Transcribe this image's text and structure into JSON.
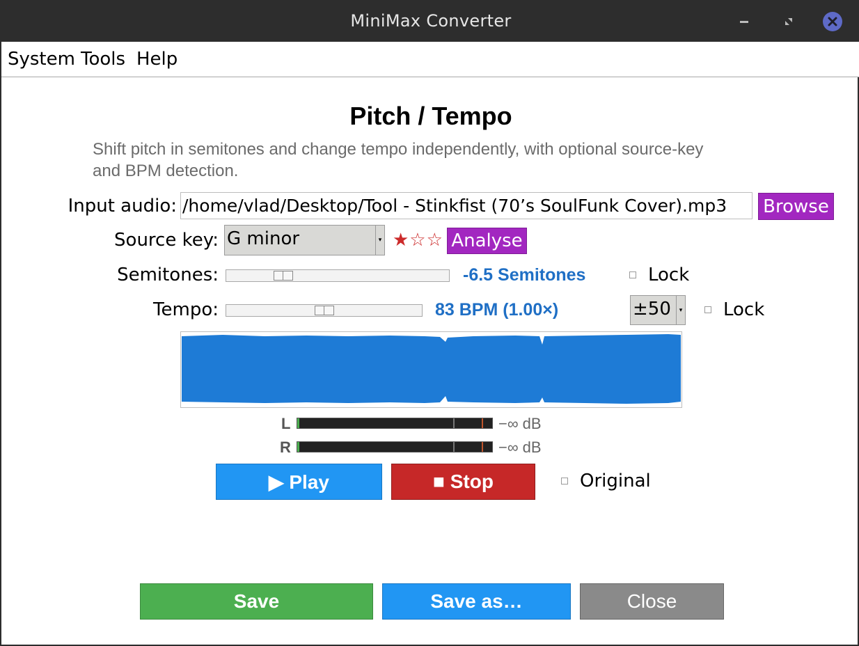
{
  "window": {
    "title": "MiniMax Converter"
  },
  "menu": {
    "items": [
      "System",
      "Tools",
      "Help"
    ]
  },
  "page": {
    "heading": "Pitch / Tempo",
    "description_line1": "Shift pitch in semitones and change tempo independently, with optional source-key",
    "description_line2": "and BPM detection."
  },
  "input": {
    "label": "Input audio:",
    "value": "/home/vlad/Desktop/Tool - Stinkfist (70’s SoulFunk Cover).mp3",
    "browse_label": "Browse"
  },
  "source_key": {
    "label": "Source key:",
    "value": "G minor",
    "stars": "★☆☆",
    "confidence_filled": 1,
    "confidence_max": 3,
    "analyse_label": "Analyse"
  },
  "semitones": {
    "label": "Semitones:",
    "value_text": "-6.5 Semitones",
    "slider_position": 0.27,
    "lock_label": "Lock",
    "locked": false
  },
  "tempo": {
    "label": "Tempo:",
    "value_text": "83 BPM (1.00×)",
    "slider_position": 0.5,
    "range_value": "±50",
    "lock_label": "Lock",
    "locked": false
  },
  "meters": {
    "left_label": "L",
    "right_label": "R",
    "left_db": "−∞ dB",
    "right_db": "−∞ dB"
  },
  "transport": {
    "play_label": "▶ Play",
    "stop_label": "■ Stop",
    "original_label": "Original",
    "original_checked": false
  },
  "footer": {
    "save_label": "Save",
    "save_as_label": "Save as…",
    "close_label": "Close"
  },
  "colors": {
    "accent_purple": "#a227c0",
    "value_blue": "#1f6fc5",
    "waveform_blue": "#1e7bd6",
    "play_blue": "#2196f3",
    "stop_red": "#c62828",
    "save_green": "#4caf50",
    "close_gray": "#8a8a8a"
  }
}
